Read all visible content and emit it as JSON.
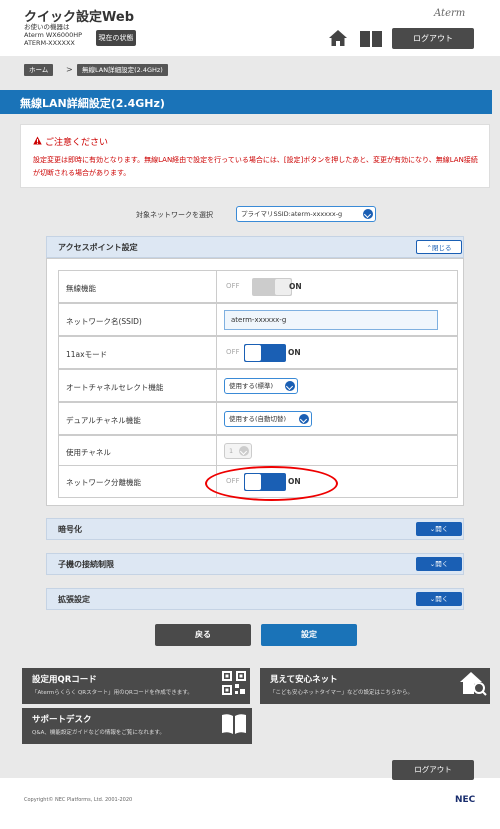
{
  "header": {
    "app_title": "クイック設定Web",
    "device_lines": [
      "お使いの機器は",
      "Aterm WX6000HP",
      "ATERM-XXXXXX"
    ],
    "status_button": "現在の状態",
    "brand": "Aterm",
    "logout": "ログアウト"
  },
  "breadcrumb": {
    "home": "ホーム",
    "separator": ">",
    "current": "無線LAN詳細設定(2.4GHz)"
  },
  "page_title": "無線LAN詳細設定(2.4GHz)",
  "notice": {
    "heading": "ご注意ください",
    "body": "設定変更は即時に有効となります。無線LAN経由で設定を行っている場合には、[設定]ボタンを押したあと、変更が有効になり、無線LAN接続が切断される場合があります。"
  },
  "network_select": {
    "label": "対象ネットワークを選択",
    "value": "プライマリSSID:aterm-xxxxxx-g"
  },
  "access_point": {
    "title": "アクセスポイント設定",
    "close_label": "閉じる",
    "rows": [
      {
        "label": "無線機能",
        "off": "OFF",
        "on": "ON",
        "state": "disabled"
      },
      {
        "label": "ネットワーク名(SSID)",
        "value": "aterm-xxxxxx-g"
      },
      {
        "label": "11axモード",
        "off": "OFF",
        "on": "ON",
        "state": "on"
      },
      {
        "label": "オートチャネルセレクト機能",
        "select": "使用する(標準)"
      },
      {
        "label": "デュアルチャネル機能",
        "select": "使用する(自動切替)"
      },
      {
        "label": "使用チャネル",
        "select": "1"
      },
      {
        "label": "ネットワーク分離機能",
        "off": "OFF",
        "on": "ON",
        "state": "on"
      }
    ]
  },
  "sections": [
    {
      "title": "暗号化",
      "open_label": "開く"
    },
    {
      "title": "子機の接続制限",
      "open_label": "開く"
    },
    {
      "title": "拡張設定",
      "open_label": "開く"
    }
  ],
  "buttons": {
    "back": "戻る",
    "save": "設定"
  },
  "cards": [
    {
      "title": "設定用QRコード",
      "desc": "「Atermらくらく QRスタート」用のQRコードを作成できます。",
      "icon": "qr-code-icon"
    },
    {
      "title": "見えて安心ネット",
      "desc": "「こども安心ネットタイマー」などの設定はこちらから。",
      "icon": "home-search-icon"
    },
    {
      "title": "サポートデスク",
      "desc": "Q&A、機能設定ガイドなどの情報をご覧になれます。",
      "icon": "book-icon"
    }
  ],
  "footer": {
    "logout": "ログアウト",
    "copyright": "Copyright© NEC Platforms, Ltd. 2001-2020",
    "logo": "NEC"
  },
  "colors": {
    "accent": "#1a73b8",
    "toggle_on": "#1a5fb4",
    "dark_button": "#4a4a4a",
    "alert": "#cc0000",
    "highlight_circle": "#ee0000"
  }
}
